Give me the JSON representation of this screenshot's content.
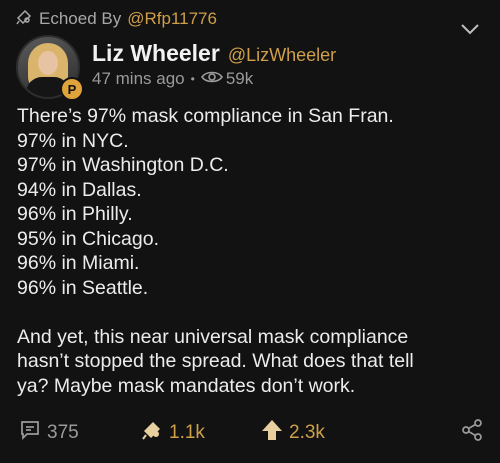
{
  "echo": {
    "label": "Echoed By",
    "handle": "@Rfp11776"
  },
  "author": {
    "name": "Liz Wheeler",
    "handle": "@LizWheeler",
    "time": "47 mins ago",
    "separator": "•",
    "views": "59k"
  },
  "post": {
    "lines": [
      "There’s 97% mask compliance in San Fran.",
      "97% in NYC.",
      "97% in Washington D.C.",
      "94% in Dallas.",
      "96% in Philly.",
      "95% in Chicago.",
      "96% in Miami.",
      "96% in Seattle."
    ],
    "closing_lines": [
      "And yet, this near universal mask compliance",
      "hasn’t stopped the spread. What does that tell",
      "ya? Maybe mask mandates don’t work."
    ]
  },
  "actions": {
    "comments": "375",
    "echoes": "1.1k",
    "upvotes": "2.3k"
  },
  "colors": {
    "background": "#121212",
    "accent_gold": "#cf9f4a",
    "muted": "#9a9a9a",
    "text": "#ececec"
  },
  "icons": {
    "echo": "megaphone-icon",
    "chevron": "chevron-down-icon",
    "badge": "parler-badge-icon",
    "views": "eye-icon",
    "comment": "comment-icon",
    "echo_action": "echo-megaphone-icon",
    "upvote": "upvote-arrow-icon",
    "share": "share-icon"
  }
}
